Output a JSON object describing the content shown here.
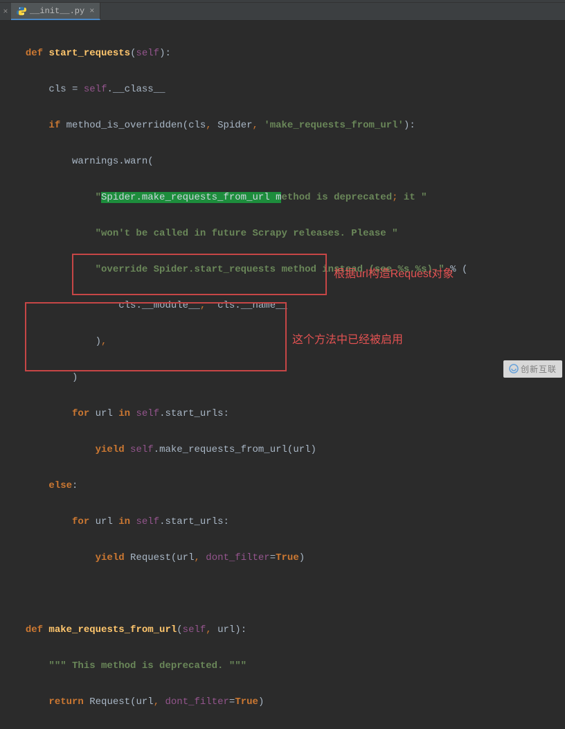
{
  "tab": {
    "filename": "__init__.py",
    "left_close": "×",
    "tab_close": "×"
  },
  "code": {
    "l1_def": "def",
    "l1_fn": "start_requests",
    "l1_p_open": "(",
    "l1_self": "self",
    "l1_p_close": ")",
    "l1_colon": ":",
    "l2_cls": "cls",
    "l2_eq": " = ",
    "l2_self": "self",
    "l2_dot": ".",
    "l2_attr": "__class__",
    "l3_if": "if",
    "l3_call": " method_is_overridden",
    "l3_p_open": "(",
    "l3_arg1": "cls",
    "l3_comma1": ",",
    "l3_arg2": " Spider",
    "l3_comma2": ",",
    "l3_str": " 'make_requests_from_url'",
    "l3_p_close": ")",
    "l3_colon": ":",
    "l4_call": "warnings",
    "l4_dot": ".",
    "l4_warn": "warn",
    "l4_p_open": "(",
    "l5_q1": "\"",
    "l5_hl": "Spider.make_requests_from_url m",
    "l5_rest": "ethod is deprecated",
    "l5_semi": ";",
    "l5_rest2": " it \"",
    "l6_str": "\"won't be called in future Scrapy releases. Please \"",
    "l7_str": "\"override Spider.start_requests method instead (see %s.%s).\"",
    "l7_pct": " % ",
    "l7_p_open": "(",
    "l8_a": "cls",
    "l8_dot1": ".",
    "l8_b": "__module__",
    "l8_comma": ",",
    "l8_c": "  cls",
    "l8_dot2": ".",
    "l8_d": "__name__",
    "l9_p_close": ")",
    "l9_comma": ",",
    "l10_p_close": ")",
    "l11_for": "for",
    "l11_url": " url ",
    "l11_in": "in",
    "l11_self": " self",
    "l11_dot": ".",
    "l11_attr": "start_urls",
    "l11_colon": ":",
    "l12_yield": "yield",
    "l12_self": " self",
    "l12_dot": ".",
    "l12_call": "make_requests_from_url",
    "l12_p_open": "(",
    "l12_arg": "url",
    "l12_p_close": ")",
    "l13_else": "else",
    "l13_colon": ":",
    "l14_for": "for",
    "l14_url": " url ",
    "l14_in": "in",
    "l14_self": " self",
    "l14_dot": ".",
    "l14_attr": "start_urls",
    "l14_colon": ":",
    "l15_yield": "yield",
    "l15_req": " Request",
    "l15_p_open": "(",
    "l15_arg": "url",
    "l15_comma": ",",
    "l15_kw": " dont_filter",
    "l15_eq": "=",
    "l15_true": "True",
    "l15_p_close": ")",
    "l17_def": "def",
    "l17_fn": " make_requests_from_url",
    "l17_p_open": "(",
    "l17_self": "self",
    "l17_comma": ",",
    "l17_url": " url",
    "l17_p_close": ")",
    "l17_colon": ":",
    "l18_str": "\"\"\" This method is deprecated. \"\"\"",
    "l19_return": "return",
    "l19_req": " Request",
    "l19_p_open": "(",
    "l19_arg": "url",
    "l19_comma": ",",
    "l19_kw": " dont_filter",
    "l19_eq": "=",
    "l19_true": "True",
    "l19_p_close": ")"
  },
  "annotations": {
    "a1": "根据url构造Request对象",
    "a2": "这个方法中已经被启用"
  },
  "watermark": "创新互联"
}
